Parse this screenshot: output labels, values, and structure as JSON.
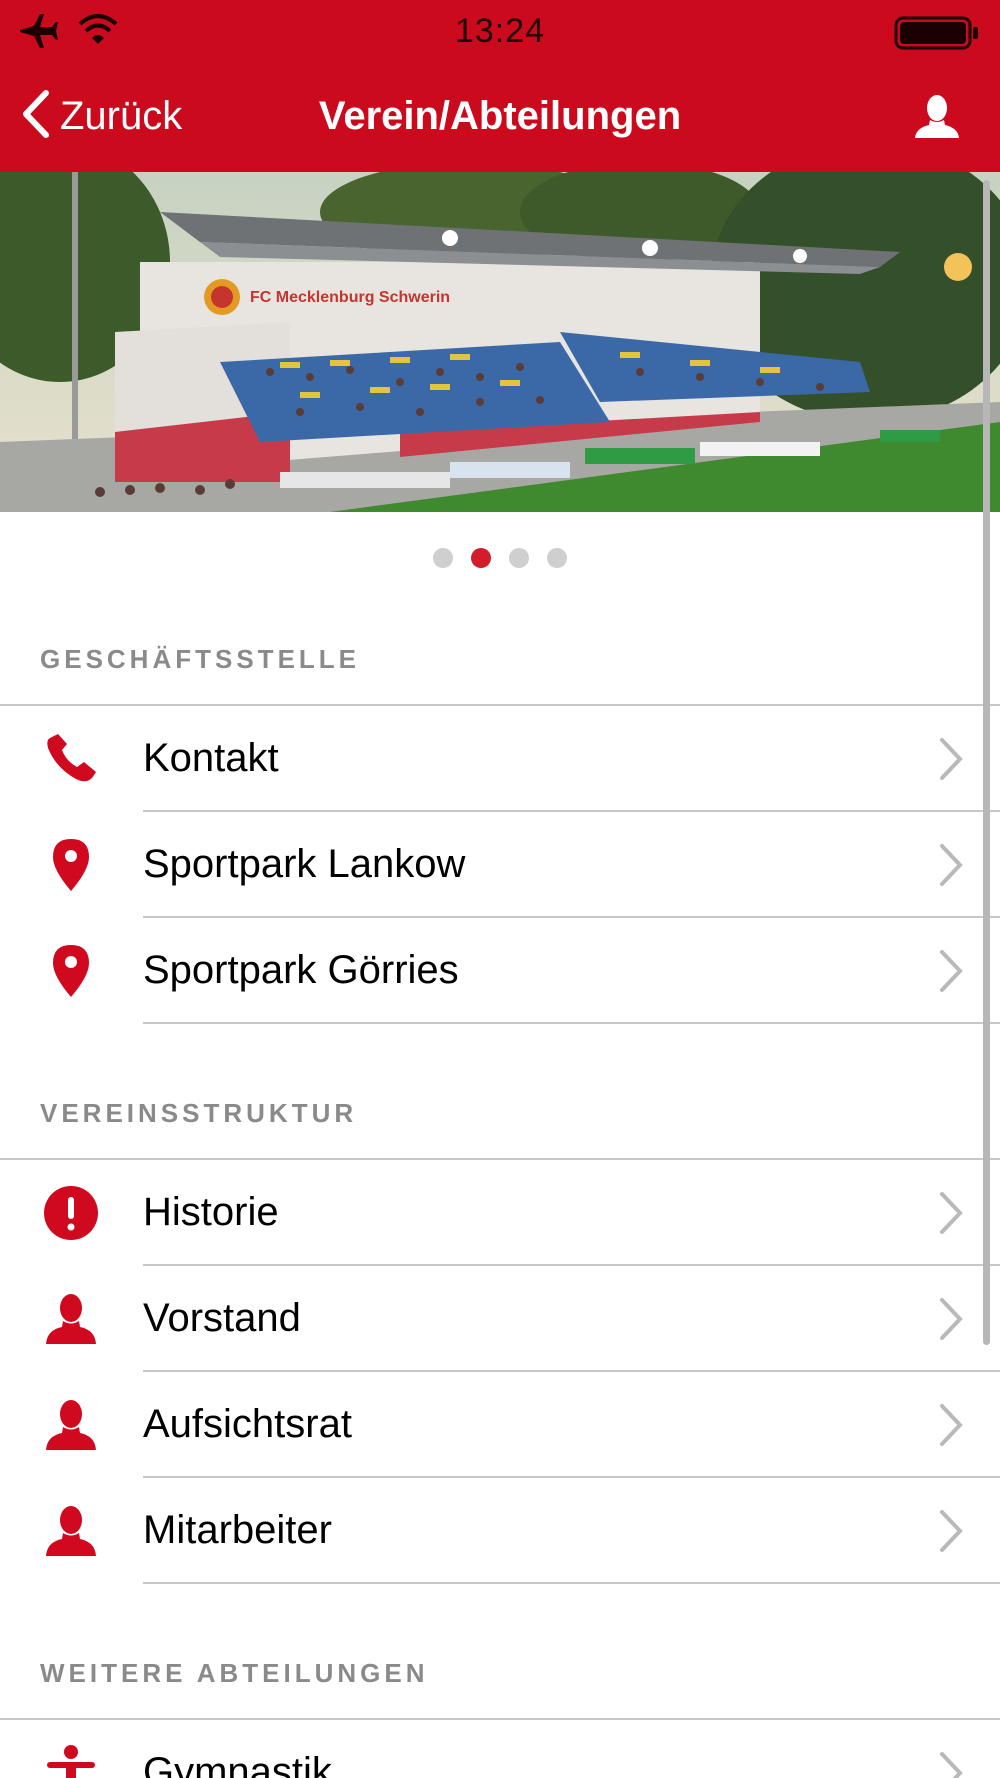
{
  "status_bar": {
    "time": "13:24"
  },
  "nav": {
    "back_label": "Zurück",
    "title": "Verein/Abteilungen"
  },
  "hero": {
    "banner_text": "FC Mecklenburg Schwerin"
  },
  "pager": {
    "count": 4,
    "active_index": 1
  },
  "sections": [
    {
      "header": "GESCHÄFTSSTELLE",
      "items": [
        {
          "label": "Kontakt",
          "icon": "phone-icon"
        },
        {
          "label": "Sportpark Lankow",
          "icon": "location-pin-icon"
        },
        {
          "label": "Sportpark Görries",
          "icon": "location-pin-icon"
        }
      ]
    },
    {
      "header": "VEREINSSTRUKTUR",
      "items": [
        {
          "label": "Historie",
          "icon": "exclamation-circle-icon"
        },
        {
          "label": "Vorstand",
          "icon": "person-icon"
        },
        {
          "label": "Aufsichtsrat",
          "icon": "person-icon"
        },
        {
          "label": "Mitarbeiter",
          "icon": "person-icon"
        }
      ]
    },
    {
      "header": "WEITERE ABTEILUNGEN",
      "items": [
        {
          "label": "Gymnastik",
          "icon": "gymnastics-icon"
        }
      ]
    }
  ],
  "colors": {
    "brand_red": "#cc0a1d",
    "icon_red": "#d0091f",
    "separator": "#c8c8c8"
  }
}
